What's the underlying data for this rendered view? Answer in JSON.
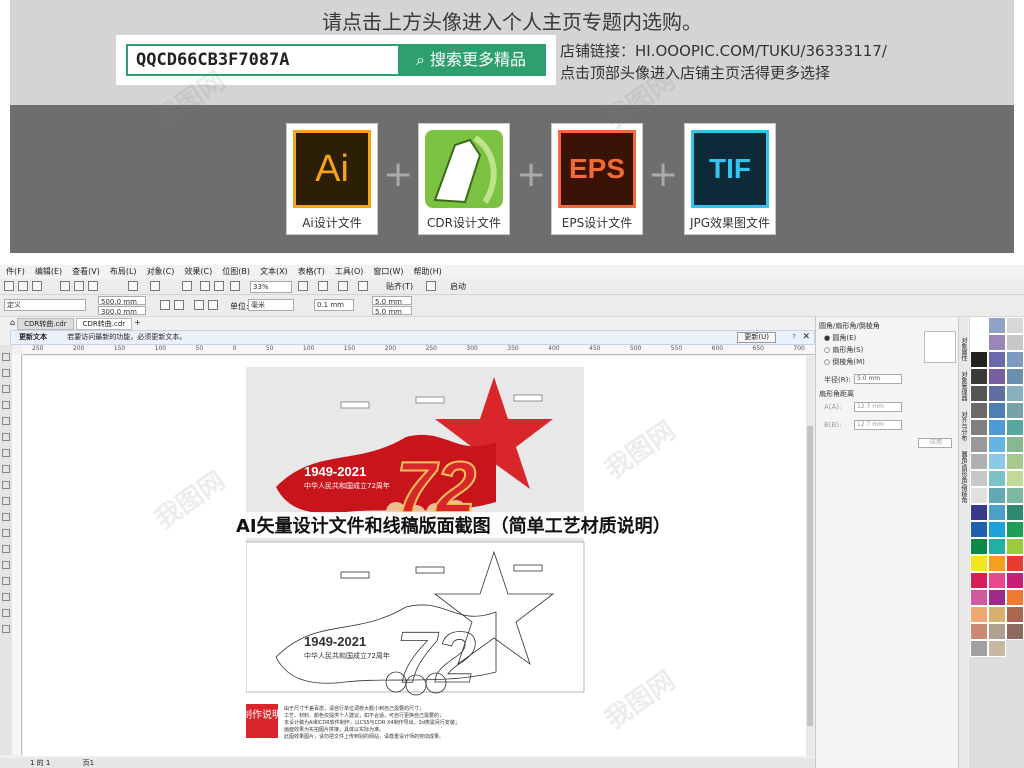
{
  "banner": {
    "title": "请点击上方头像进入个人主页专题内选购。",
    "code": "QQCD66CB3F7087A",
    "search_label": "搜索更多精品",
    "shop_line1": "店铺链接：HI.OOOPIC.COM/TUKU/36333117/",
    "shop_line2": "点击顶部头像进入店铺主页活得更多选择"
  },
  "formats": [
    {
      "abbr": "Ai",
      "label": "Ai设计文件",
      "color": "#f7a21b",
      "bg": "#2b1f08"
    },
    {
      "abbr": "",
      "label": "CDR设计文件",
      "color": "#7cc242",
      "bg": "#e9f3d8"
    },
    {
      "abbr": "EPS",
      "label": "EPS设计文件",
      "color": "#f26a35",
      "bg": "#3a1206"
    },
    {
      "abbr": "TIF",
      "label": "JPG效果图文件",
      "color": "#34c4ee",
      "bg": "#0c2a38"
    }
  ],
  "plus": "+",
  "app": {
    "menu": [
      "件(F)",
      "编辑(E)",
      "查看(V)",
      "布局(L)",
      "对象(C)",
      "效果(C)",
      "位图(B)",
      "文本(X)",
      "表格(T)",
      "工具(O)",
      "窗口(W)",
      "帮助(H)"
    ],
    "zoom": "33%",
    "snap_label": "贴齐(T)",
    "launch_label": "启动",
    "preset": "定义",
    "width_val": "500.0 mm",
    "height_val": "300.0 mm",
    "unit_label": "单位:",
    "unit_val": "毫米",
    "nudge_val": "0.1 mm",
    "dup_x": "5.0 mm",
    "dup_y": "5.0 mm",
    "tabs": [
      "CDR转曲.cdr",
      "CDR转曲.cdr"
    ],
    "notice_title": "更新文本",
    "notice_text": "若要访问最新的功能，必须更新文本。",
    "update_label": "更新(U)",
    "ruler_ticks": [
      "250",
      "200",
      "150",
      "100",
      "50",
      "0",
      "50",
      "100",
      "150",
      "200",
      "250",
      "300",
      "350",
      "400",
      "450",
      "500",
      "550",
      "600",
      "650",
      "700"
    ],
    "page_nav": "1 的 1",
    "page_label": "页1"
  },
  "dock": {
    "title": "圆角/扇形角/倒棱角",
    "options": [
      "圆角(E)",
      "扇形角(S)",
      "倒棱角(M)"
    ],
    "radius_label": "半径(R):",
    "radius_val": "5.0 mm",
    "dist_label": "扇形角距离",
    "a_label": "A(A):",
    "a_val": "12.7 mm",
    "b_label": "B(B):",
    "b_val": "12.7 mm",
    "apply_label": "应用",
    "side_tabs": [
      "对象属性",
      "对象管理器",
      "对齐与分布",
      "圆角/扇形角/倒棱角"
    ]
  },
  "palette": [
    "#ffffff",
    "#8fa3c8",
    "#d7d7d7",
    "#ffffff",
    "#9a86b8",
    "#c8c8c8",
    "#222222",
    "#6a6aa8",
    "#7c9bc0",
    "#3a3a3a",
    "#7a5fa0",
    "#6b8fae",
    "#555555",
    "#5f6f9f",
    "#8ab0c0",
    "#6a6a6a",
    "#4f7fb0",
    "#7aa0a8",
    "#808080",
    "#4d9bd4",
    "#58a7a0",
    "#999999",
    "#66b5e0",
    "#88b890",
    "#b0b0b0",
    "#8cc8e8",
    "#a7c98f",
    "#c8c8c8",
    "#7cc0c8",
    "#c3d99a",
    "#e0e0e0",
    "#64a8b8",
    "#7fb6a0",
    "#3a3a8c",
    "#4aa0c8",
    "#2e8a6e",
    "#2060b0",
    "#1ea0d8",
    "#1e9e58",
    "#0a8a4a",
    "#22b0a0",
    "#9acb3c",
    "#f5e51c",
    "#f5a01c",
    "#e83a30",
    "#d81e5a",
    "#e8488c",
    "#c81e7a",
    "#d05aa0",
    "#9e2a8a",
    "#ef7a30",
    "#f0a870",
    "#d8b070",
    "#a86850",
    "#c88a70",
    "#b0a090",
    "#8c6a60",
    "#a0a0a0",
    "#c8b8a0"
  ],
  "artboard": {
    "years": "1949-2021",
    "subtitle": "中华人民共和国成立72周年",
    "number": "72",
    "plan_label": "制作说明",
    "plan_notes": [
      "由于尺寸千差百态，请自行单位调校大概小到自己需要的尺寸；",
      "工艺、材料、颜色仅提供个人建议，如不合适，可自行更换自己需要的；",
      "本设计稿为AI和CDR软件制作，以CS5与CDR X4制作导出，3d类需另行安装；",
      "画面效果为实拍图片拼接，具体以实际为准。",
      "此图效果图片，请勿把文件上传到别的网站，请尊重设计师的劳动成果。"
    ]
  },
  "overlay_title": "AI矢量设计文件和线稿版面截图（简单工艺材质说明）",
  "watermark": "我图网"
}
